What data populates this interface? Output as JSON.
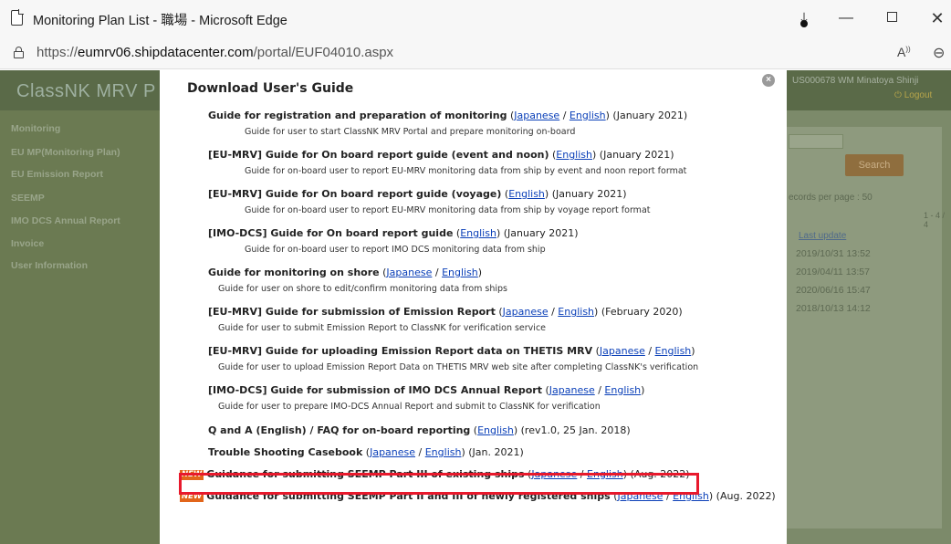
{
  "window": {
    "title": "Monitoring Plan List - 職場 - Microsoft Edge",
    "minimize": "—",
    "close": "✕"
  },
  "address": {
    "url_prefix": "https://",
    "url_host": "eumrv06.shipdatacenter.com",
    "url_path": "/portal/EUF04010.aspx",
    "read_aloud": "A",
    "zoom": "⊖"
  },
  "portal": {
    "brand": "ClassNK MRV P",
    "user": "US000678 WM Minatoya Shinji",
    "logout": "Logout",
    "menu": [
      "Monitoring",
      "EU MP(Monitoring Plan)",
      "EU Emission Report",
      "SEEMP",
      "IMO DCS Annual Report",
      "Invoice",
      "User Information"
    ],
    "search_label": "Search",
    "records_per_page": "ecords per page : 50",
    "pager": "1 - 4 / 4",
    "last_update": "Last update",
    "dates": [
      "2019/10/31 13:52",
      "2019/04/11 13:57",
      "2020/06/16 15:47",
      "2018/10/13 14:12"
    ]
  },
  "modal": {
    "title": "Download User's Guide",
    "close": "×",
    "sep": " / ",
    "open_paren": " (",
    "close_paren": ")",
    "entries": [
      {
        "title": "Guide for registration and preparation of monitoring",
        "links": [
          "Japanese",
          "English"
        ],
        "date": " (January 2021)",
        "desc": "Guide for user to start ClassNK MRV Portal and prepare monitoring on-board"
      },
      {
        "title": "[EU-MRV] Guide for On board report guide (event and noon)",
        "links": [
          "English"
        ],
        "date": " (January 2021)",
        "desc": "Guide for on-board user to report EU-MRV monitoring data from ship by event and noon report format"
      },
      {
        "title": "[EU-MRV] Guide for On board report guide (voyage)",
        "links": [
          "English"
        ],
        "date": " (January 2021)",
        "desc": "Guide for on-board user to report EU-MRV monitoring data from ship by voyage report format"
      },
      {
        "title": "[IMO-DCS] Guide for On board report guide",
        "links": [
          "English"
        ],
        "date": " (January 2021)",
        "desc": "Guide for on-board user to report IMO DCS monitoring data from ship"
      },
      {
        "title": "Guide for monitoring on shore",
        "links": [
          "Japanese",
          "English"
        ],
        "date": "",
        "desc": "Guide for user on shore to edit/confirm monitoring data from ships"
      },
      {
        "title": "[EU-MRV] Guide for submission of Emission Report",
        "links": [
          "Japanese",
          "English"
        ],
        "date": " (February 2020)",
        "desc": "Guide for user to submit Emission Report to ClassNK for verification service"
      },
      {
        "title": "[EU-MRV] Guide for uploading Emission Report data on THETIS MRV",
        "links": [
          "Japanese",
          "English"
        ],
        "date": "",
        "desc": "Guide for user to upload Emission Report Data on THETIS MRV web site after completing ClassNK's verification"
      },
      {
        "title": "[IMO-DCS] Guide for submission of IMO DCS Annual Report",
        "links": [
          "Japanese",
          "English"
        ],
        "date": "",
        "desc": "Guide for user to prepare IMO-DCS Annual Report and submit to ClassNK for verification"
      },
      {
        "title": "Q and A (English) / FAQ for on-board reporting",
        "links": [
          "English"
        ],
        "date": " (rev1.0, 25 Jan. 2018)",
        "desc": ""
      },
      {
        "title": "Trouble Shooting Casebook",
        "links": [
          "Japanese",
          "English"
        ],
        "date": " (Jan. 2021)",
        "desc": ""
      },
      {
        "title": "Guidance for submitting SEEMP Part III of existing ships",
        "links": [
          "Japanese",
          "English"
        ],
        "date": " (Aug. 2022)",
        "desc": "",
        "new": "NEW"
      },
      {
        "title": "Guidance for submitting SEEMP Part II and III of newly registered ships",
        "links": [
          "Japanese",
          "English"
        ],
        "date": " (Aug. 2022)",
        "desc": "",
        "new": "NEW"
      }
    ]
  },
  "colors": {
    "link": "#0a3fb8",
    "highlight": "#e8192c",
    "new_badge": "#e2651b"
  }
}
